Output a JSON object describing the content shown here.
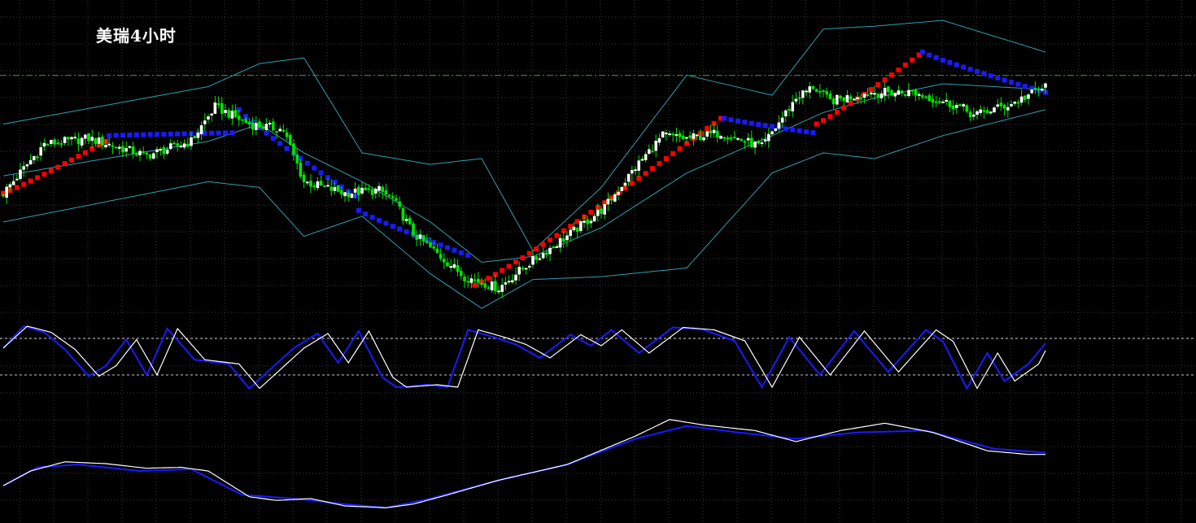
{
  "title": "美瑞4小时",
  "colors": {
    "background": "#000000",
    "grid": "#3a3a3a",
    "bullish_candle": "#ffffff",
    "bearish_candle": "#00e600",
    "wick": "#00e600",
    "bollinger": "#2fa0b0",
    "reference_line": "#5a9a3a",
    "sar_up": "#ff0000",
    "sar_down": "#1a1aff",
    "stoch_main": "#1a1aff",
    "stoch_signal": "#ffffff",
    "level_line": "#c8c8c8",
    "osc2_main": "#1a1aff",
    "osc2_signal": "#ffffff"
  },
  "chart_data": [
    {
      "type": "candlestick",
      "title": "美瑞4小时",
      "grid": true,
      "ylim": [
        0,
        100
      ],
      "reference_level": 78.9,
      "anchors": [
        [
          0,
          38
        ],
        [
          12,
          55
        ],
        [
          25,
          57
        ],
        [
          42,
          51
        ],
        [
          55,
          56
        ],
        [
          62,
          68
        ],
        [
          72,
          62
        ],
        [
          82,
          60
        ],
        [
          88,
          42
        ],
        [
          100,
          38
        ],
        [
          110,
          39
        ],
        [
          114,
          36
        ],
        [
          120,
          24
        ],
        [
          135,
          9
        ],
        [
          145,
          5
        ],
        [
          152,
          12
        ],
        [
          166,
          24
        ],
        [
          176,
          33
        ],
        [
          185,
          47
        ],
        [
          193,
          58
        ],
        [
          200,
          57
        ],
        [
          210,
          59
        ],
        [
          222,
          54
        ],
        [
          232,
          71
        ],
        [
          237,
          75
        ],
        [
          242,
          70
        ],
        [
          254,
          73
        ],
        [
          266,
          73
        ],
        [
          280,
          68
        ],
        [
          284,
          65
        ],
        [
          295,
          69
        ],
        [
          305,
          75
        ]
      ],
      "bollinger_anchors": [
        {
          "i": 0,
          "mid": 44,
          "upper": 62,
          "lower": 28
        },
        {
          "i": 60,
          "mid": 56,
          "upper": 75,
          "lower": 42
        },
        {
          "i": 75,
          "mid": 62,
          "upper": 83,
          "lower": 40
        },
        {
          "i": 88,
          "mid": 52,
          "upper": 85,
          "lower": 23
        },
        {
          "i": 105,
          "mid": 42,
          "upper": 52,
          "lower": 30
        },
        {
          "i": 125,
          "mid": 28,
          "upper": 48,
          "lower": 10
        },
        {
          "i": 140,
          "mid": 14,
          "upper": 50,
          "lower": -2
        },
        {
          "i": 155,
          "mid": 16,
          "upper": 18,
          "lower": 8
        },
        {
          "i": 175,
          "mid": 26,
          "upper": 40,
          "lower": 9
        },
        {
          "i": 200,
          "mid": 45,
          "upper": 79,
          "lower": 12
        },
        {
          "i": 225,
          "mid": 58,
          "upper": 72,
          "lower": 45
        },
        {
          "i": 240,
          "mid": 66,
          "upper": 95,
          "lower": 52
        },
        {
          "i": 255,
          "mid": 71,
          "upper": 96,
          "lower": 50
        },
        {
          "i": 275,
          "mid": 76,
          "upper": 98,
          "lower": 58
        },
        {
          "i": 305,
          "mid": 74,
          "upper": 87,
          "lower": 67
        }
      ],
      "sar_segments": [
        {
          "from": 0,
          "to": 30,
          "dir": "up",
          "start": 38,
          "end": 56
        },
        {
          "from": 31,
          "to": 68,
          "dir": "down",
          "start": 58,
          "end": 59
        },
        {
          "from": 69,
          "to": 103,
          "dir": "down",
          "start": 67,
          "end": 37
        },
        {
          "from": 104,
          "to": 137,
          "dir": "down",
          "start": 32,
          "end": 16
        },
        {
          "from": 138,
          "to": 210,
          "dir": "up",
          "start": 6,
          "end": 64
        },
        {
          "from": 211,
          "to": 237,
          "dir": "down",
          "start": 64,
          "end": 59
        },
        {
          "from": 238,
          "to": 268,
          "dir": "up",
          "start": 62,
          "end": 86
        },
        {
          "from": 269,
          "to": 305,
          "dir": "down",
          "start": 87,
          "end": 73
        }
      ]
    },
    {
      "type": "line",
      "levels": [
        80,
        20
      ],
      "ylim": [
        0,
        100
      ],
      "series": [
        {
          "role": "main",
          "anchors": [
            [
              0,
              64
            ],
            [
              6,
              100
            ],
            [
              12,
              90
            ],
            [
              18,
              62
            ],
            [
              25,
              18
            ],
            [
              30,
              35
            ],
            [
              36,
              78
            ],
            [
              42,
              20
            ],
            [
              48,
              96
            ],
            [
              56,
              45
            ],
            [
              66,
              38
            ],
            [
              72,
              -2
            ],
            [
              85,
              64
            ],
            [
              92,
              88
            ],
            [
              98,
              40
            ],
            [
              104,
              92
            ],
            [
              111,
              16
            ],
            [
              115,
              0
            ],
            [
              124,
              4
            ],
            [
              130,
              0
            ],
            [
              136,
              94
            ],
            [
              143,
              83
            ],
            [
              150,
              70
            ],
            [
              157,
              48
            ],
            [
              166,
              86
            ],
            [
              172,
              68
            ],
            [
              178,
              94
            ],
            [
              186,
              56
            ],
            [
              196,
              98
            ],
            [
              205,
              94
            ],
            [
              214,
              76
            ],
            [
              222,
              0
            ],
            [
              230,
              82
            ],
            [
              239,
              20
            ],
            [
              249,
              92
            ],
            [
              259,
              25
            ],
            [
              270,
              94
            ],
            [
              275,
              75
            ],
            [
              282,
              -2
            ],
            [
              288,
              56
            ],
            [
              293,
              10
            ],
            [
              300,
              38
            ],
            [
              305,
              72
            ]
          ]
        },
        {
          "role": "signal",
          "anchors": [
            [
              0,
              64
            ],
            [
              7,
              100
            ],
            [
              14,
              90
            ],
            [
              21,
              62
            ],
            [
              28,
              18
            ],
            [
              33,
              35
            ],
            [
              39,
              78
            ],
            [
              45,
              20
            ],
            [
              51,
              96
            ],
            [
              59,
              45
            ],
            [
              69,
              38
            ],
            [
              75,
              -2
            ],
            [
              88,
              64
            ],
            [
              95,
              88
            ],
            [
              101,
              40
            ],
            [
              107,
              92
            ],
            [
              114,
              16
            ],
            [
              118,
              0
            ],
            [
              127,
              4
            ],
            [
              133,
              0
            ],
            [
              139,
              94
            ],
            [
              146,
              83
            ],
            [
              153,
              70
            ],
            [
              160,
              48
            ],
            [
              169,
              86
            ],
            [
              175,
              68
            ],
            [
              181,
              94
            ],
            [
              189,
              56
            ],
            [
              199,
              98
            ],
            [
              208,
              94
            ],
            [
              217,
              76
            ],
            [
              225,
              0
            ],
            [
              233,
              82
            ],
            [
              242,
              20
            ],
            [
              252,
              92
            ],
            [
              262,
              25
            ],
            [
              273,
              94
            ],
            [
              278,
              75
            ],
            [
              285,
              -2
            ],
            [
              291,
              56
            ],
            [
              296,
              10
            ],
            [
              303,
              38
            ],
            [
              305,
              60
            ]
          ]
        }
      ]
    },
    {
      "type": "line",
      "ylim": [
        0,
        100
      ],
      "series": [
        {
          "role": "main",
          "anchors": [
            [
              0,
              22
            ],
            [
              10,
              42
            ],
            [
              22,
              45
            ],
            [
              40,
              38
            ],
            [
              55,
              40
            ],
            [
              70,
              12
            ],
            [
              85,
              8
            ],
            [
              100,
              2
            ],
            [
              112,
              -2
            ],
            [
              125,
              8
            ],
            [
              145,
              28
            ],
            [
              165,
              45
            ],
            [
              185,
              73
            ],
            [
              200,
              87
            ],
            [
              215,
              80
            ],
            [
              232,
              73
            ],
            [
              250,
              80
            ],
            [
              270,
              82
            ],
            [
              290,
              62
            ],
            [
              305,
              58
            ]
          ]
        },
        {
          "role": "signal",
          "anchors": [
            [
              0,
              22
            ],
            [
              8,
              38
            ],
            [
              18,
              48
            ],
            [
              30,
              46
            ],
            [
              42,
              41
            ],
            [
              52,
              42
            ],
            [
              60,
              38
            ],
            [
              72,
              10
            ],
            [
              80,
              6
            ],
            [
              90,
              8
            ],
            [
              100,
              0
            ],
            [
              112,
              -2
            ],
            [
              120,
              2
            ],
            [
              130,
              12
            ],
            [
              145,
              28
            ],
            [
              165,
              45
            ],
            [
              185,
              76
            ],
            [
              195,
              94
            ],
            [
              205,
              88
            ],
            [
              220,
              82
            ],
            [
              232,
              70
            ],
            [
              245,
              82
            ],
            [
              258,
              90
            ],
            [
              272,
              80
            ],
            [
              288,
              60
            ],
            [
              300,
              56
            ],
            [
              305,
              56
            ]
          ]
        }
      ]
    }
  ]
}
